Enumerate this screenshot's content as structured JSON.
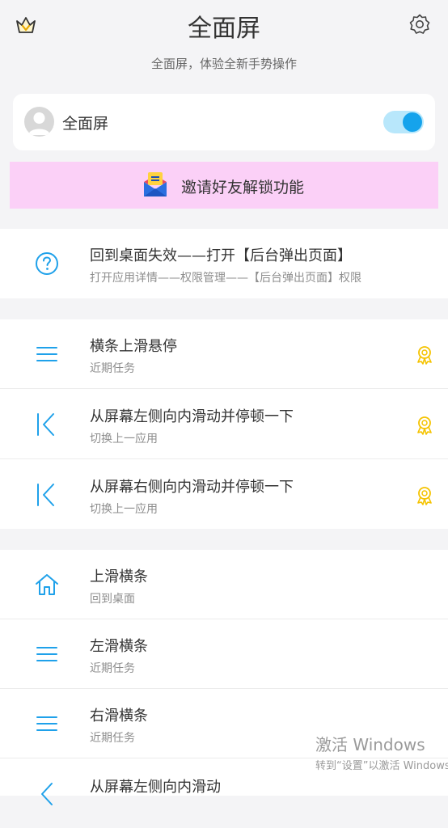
{
  "header": {
    "title": "全面屏",
    "subtitle": "全面屏，体验全新手势操作"
  },
  "switch_card": {
    "label": "全面屏",
    "enabled": true
  },
  "invite": {
    "label": "邀请好友解锁功能"
  },
  "help": {
    "title": "回到桌面失效——打开【后台弹出页面】",
    "subtitle": "打开应用详情——权限管理——【后台弹出页面】权限"
  },
  "premium_gestures": [
    {
      "icon": "menu-icon",
      "title": "横条上滑悬停",
      "subtitle": "近期任务"
    },
    {
      "icon": "back-to-start-icon",
      "title": "从屏幕左侧向内滑动并停顿一下",
      "subtitle": "切换上一应用"
    },
    {
      "icon": "back-to-start-icon",
      "title": "从屏幕右侧向内滑动并停顿一下",
      "subtitle": "切换上一应用"
    }
  ],
  "basic_gestures": [
    {
      "icon": "home-icon",
      "title": "上滑横条",
      "subtitle": "回到桌面"
    },
    {
      "icon": "menu-icon",
      "title": "左滑横条",
      "subtitle": "近期任务"
    },
    {
      "icon": "menu-icon",
      "title": "右滑横条",
      "subtitle": "近期任务"
    },
    {
      "icon": "back-arrow-icon",
      "title": "从屏幕左侧向内滑动",
      "subtitle": ""
    }
  ],
  "watermark": {
    "line1": "激活 Windows",
    "line2": "转到“设置”以激活 Windows。"
  },
  "colors": {
    "accent": "#1fa1ea",
    "toggle_track": "#b8e7fb",
    "invite_bg": "#fbd0f7",
    "badge": "#f5c300"
  }
}
